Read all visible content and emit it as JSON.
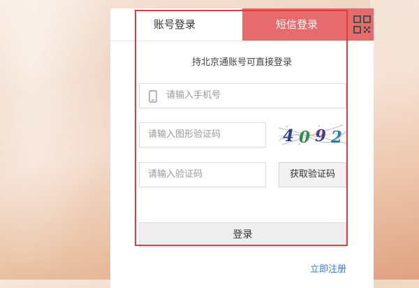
{
  "tabs": {
    "account_login": "账号登录",
    "sms_login": "短信登录"
  },
  "qr": {
    "icon": "qr-code-icon"
  },
  "subtitle": "持北京通账号可直接登录",
  "phone": {
    "placeholder": "请输入手机号",
    "icon": "mobile-phone-icon"
  },
  "captcha": {
    "placeholder": "请输入图形验证码",
    "image_text": "4092"
  },
  "sms_code": {
    "placeholder": "请输入验证码",
    "get_code_label": "获取验证码"
  },
  "login_label": "登录",
  "register_label": "立即注册",
  "colors": {
    "tab_active_bg": "#e56b6d",
    "highlight_border": "#e33b3b",
    "link": "#3a7dd6"
  }
}
